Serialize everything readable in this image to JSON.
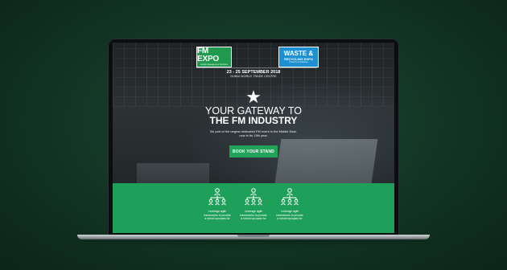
{
  "logos": {
    "fm_expo": {
      "title": "FM EXPO",
      "tagline": "Facility Management Solutions"
    },
    "waste_expo": {
      "title": "WASTE &",
      "subtitle": "RECYCLING EXPO",
      "tagline": "Products & Solutions"
    }
  },
  "event": {
    "dates": "23 - 25 SEPTEMBER 2018",
    "venue": "DUBAI WORLD TRADE CENTRE"
  },
  "hero": {
    "title_line1": "YOUR GATEWAY TO",
    "title_line2": "THE FM INDUSTRY",
    "subtitle_line1": "Be part of the largest dedicated FM event in the Middle East,",
    "subtitle_line2": "now in its 13th year."
  },
  "cta": {
    "label": "BOOK YOUR STAND"
  },
  "features": [
    {
      "icon": "org-chart-icon",
      "line1": "Leverage agile",
      "line2": "frameworks to provide",
      "line3": "a robust synopsis for"
    },
    {
      "icon": "org-chart-icon",
      "line1": "Leverage agile",
      "line2": "frameworks to provide",
      "line3": "a robust synopsis for"
    },
    {
      "icon": "org-chart-icon",
      "line1": "Leverage agile",
      "line2": "frameworks to provide",
      "line3": "a robust synopsis for"
    }
  ],
  "colors": {
    "background": "#123424",
    "brand_green": "#21a45a",
    "fm_green": "#1f9a4e",
    "waste_blue": "#1d8fd3"
  }
}
